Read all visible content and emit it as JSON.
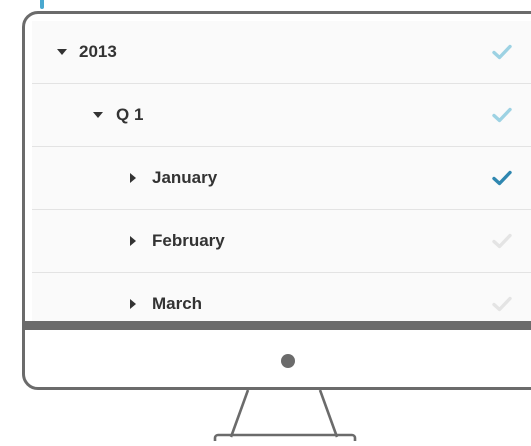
{
  "colors": {
    "frame": "#6b6b6b",
    "check_partial": "#9dd2e3",
    "check_full": "#2f87b0",
    "check_off": "#e4e4e4",
    "text": "#333333",
    "accent": "#4aa8cf"
  },
  "tree": {
    "rows": [
      {
        "label": "2013",
        "expander": "caret-down-icon",
        "check_state": "partial"
      },
      {
        "label": "Q 1",
        "expander": "caret-down-icon",
        "check_state": "partial"
      },
      {
        "label": "January",
        "expander": "caret-right-icon",
        "check_state": "checked"
      },
      {
        "label": "February",
        "expander": "caret-right-icon",
        "check_state": "unchecked"
      },
      {
        "label": "March",
        "expander": "caret-right-icon",
        "check_state": "unchecked"
      }
    ]
  }
}
